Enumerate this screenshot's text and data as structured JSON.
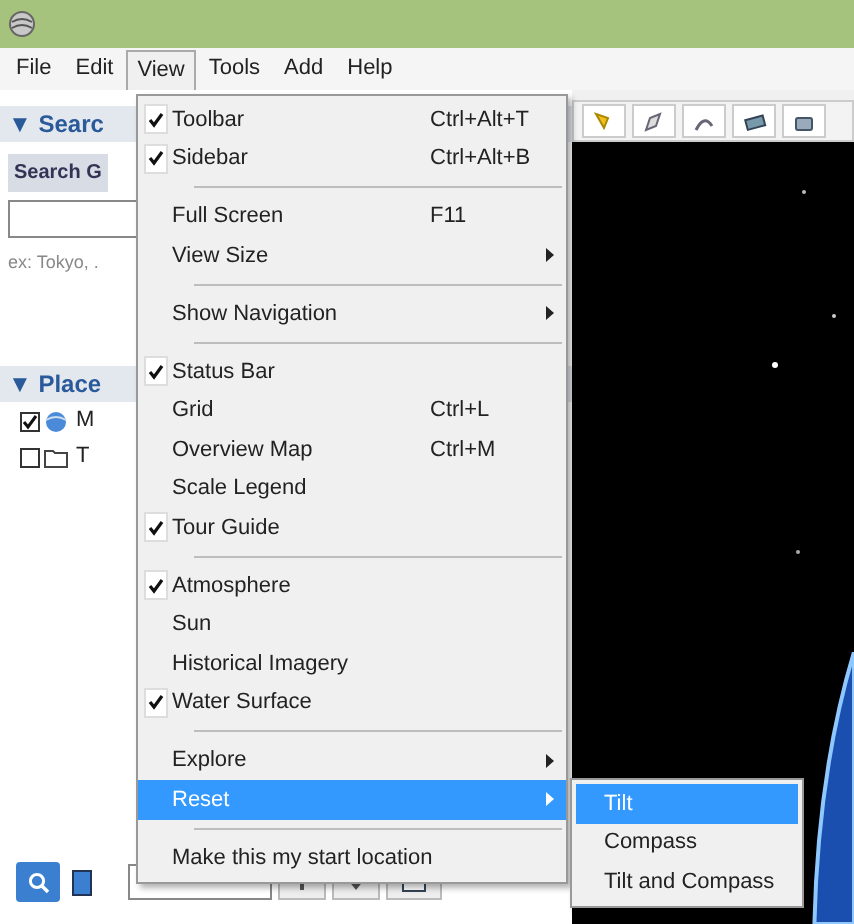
{
  "menu_bar": [
    {
      "label": "File",
      "selected": false
    },
    {
      "label": "Edit",
      "selected": false
    },
    {
      "label": "View",
      "selected": true
    },
    {
      "label": "Tools",
      "selected": false
    },
    {
      "label": "Add",
      "selected": false
    },
    {
      "label": "Help",
      "selected": false
    }
  ],
  "sidebar": {
    "search_panel": {
      "header": "▼ Searc",
      "tab": "Search G",
      "hint": "ex: Tokyo, ."
    },
    "places_panel": {
      "header": "▼ Place",
      "items": [
        {
          "label": "M",
          "checked": true,
          "kind": "globe"
        },
        {
          "label": "T",
          "checked": false,
          "kind": "folder"
        }
      ]
    }
  },
  "view_menu": {
    "groups": [
      [
        {
          "label": "Toolbar",
          "checked": true,
          "shortcut": "Ctrl+Alt+T",
          "submenu": false,
          "selected": false
        },
        {
          "label": "Sidebar",
          "checked": true,
          "shortcut": "Ctrl+Alt+B",
          "submenu": false,
          "selected": false
        }
      ],
      [
        {
          "label": "Full Screen",
          "checked": false,
          "shortcut": "F11",
          "submenu": false,
          "selected": false
        },
        {
          "label": "View Size",
          "checked": false,
          "submenu": true,
          "selected": false
        }
      ],
      [
        {
          "label": "Show Navigation",
          "checked": false,
          "submenu": true,
          "selected": false
        }
      ],
      [
        {
          "label": "Status Bar",
          "checked": true,
          "submenu": false,
          "selected": false
        },
        {
          "label": "Grid",
          "checked": false,
          "shortcut": "Ctrl+L",
          "submenu": false,
          "selected": false
        },
        {
          "label": "Overview Map",
          "checked": false,
          "shortcut": "Ctrl+M",
          "submenu": false,
          "selected": false
        },
        {
          "label": "Scale Legend",
          "checked": false,
          "submenu": false,
          "selected": false
        },
        {
          "label": "Tour Guide",
          "checked": true,
          "submenu": false,
          "selected": false
        }
      ],
      [
        {
          "label": "Atmosphere",
          "checked": true,
          "submenu": false,
          "selected": false
        },
        {
          "label": "Sun",
          "checked": false,
          "submenu": false,
          "selected": false
        },
        {
          "label": "Historical Imagery",
          "checked": false,
          "submenu": false,
          "selected": false
        },
        {
          "label": "Water Surface",
          "checked": true,
          "submenu": false,
          "selected": false
        }
      ],
      [
        {
          "label": "Explore",
          "checked": false,
          "submenu": true,
          "selected": false
        },
        {
          "label": "Reset",
          "checked": false,
          "submenu": true,
          "selected": true
        }
      ],
      [
        {
          "label": "Make this my start location",
          "checked": false,
          "submenu": false,
          "selected": false
        }
      ]
    ]
  },
  "reset_submenu": {
    "items": [
      {
        "label": "Tilt",
        "selected": true
      },
      {
        "label": "Compass",
        "selected": false
      },
      {
        "label": "Tilt and Compass",
        "selected": false
      }
    ]
  }
}
